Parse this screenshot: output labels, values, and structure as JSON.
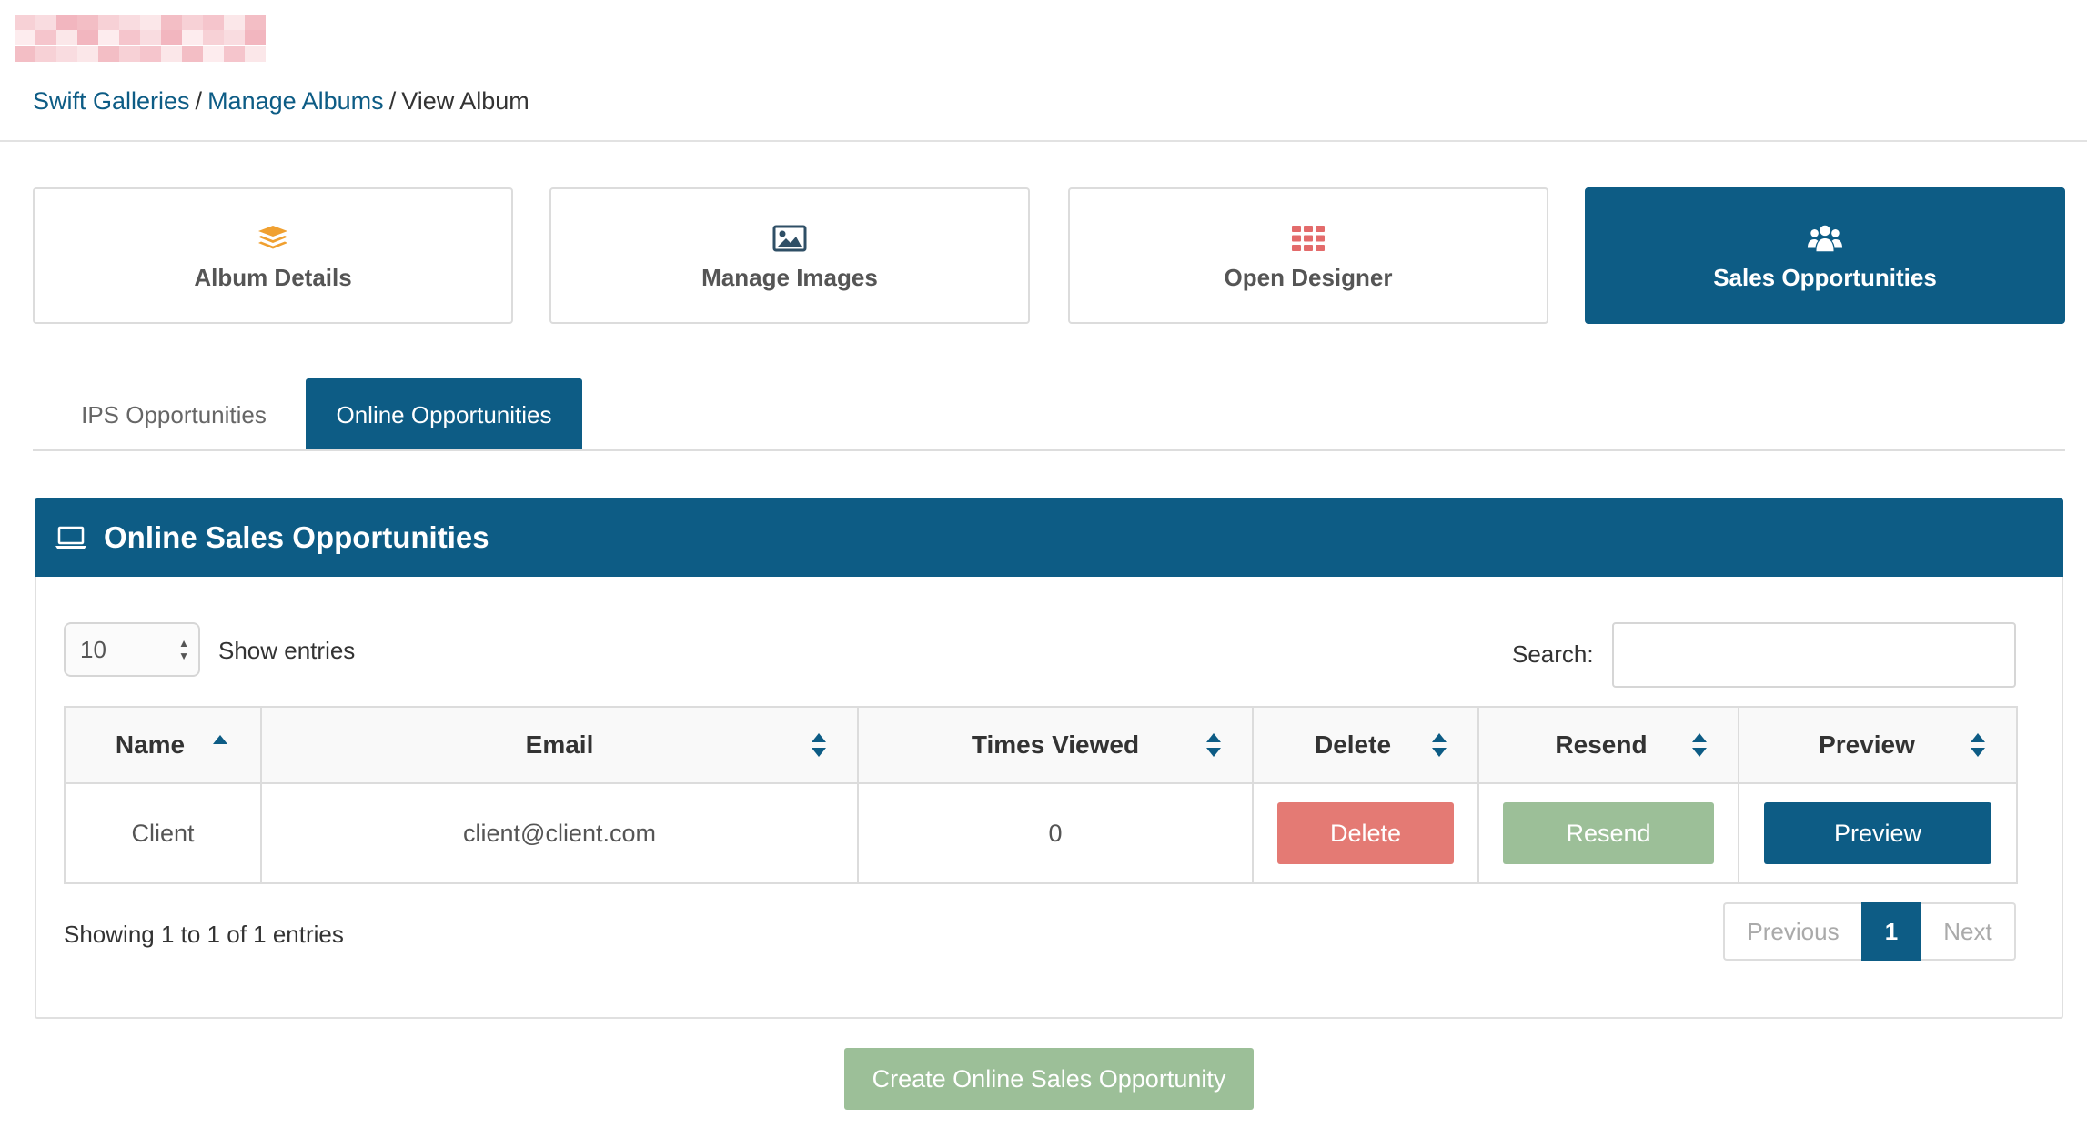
{
  "breadcrumb": {
    "root": "Swift Galleries",
    "sep1": "/",
    "albums": "Manage Albums",
    "sep2": "/",
    "current": "View Album"
  },
  "nav_cards": [
    {
      "label": "Album Details",
      "icon": "layers-icon",
      "color": "#f0a030"
    },
    {
      "label": "Manage Images",
      "icon": "image-icon",
      "color": "#2f4f66"
    },
    {
      "label": "Open Designer",
      "icon": "grid-icon",
      "color": "#e36b6b"
    },
    {
      "label": "Sales Opportunities",
      "icon": "users-icon",
      "color": "#ffffff",
      "active": true
    }
  ],
  "tabs": [
    {
      "label": "IPS Opportunities",
      "active": false
    },
    {
      "label": "Online Opportunities",
      "active": true
    }
  ],
  "panel": {
    "title": "Online Sales Opportunities",
    "icon": "laptop-icon"
  },
  "table_controls": {
    "page_length": "10",
    "show_entries": "Show entries",
    "search_label": "Search:",
    "search_value": ""
  },
  "table": {
    "columns": [
      "Name",
      "Email",
      "Times Viewed",
      "Delete",
      "Resend",
      "Preview"
    ],
    "rows": [
      {
        "name": "Client",
        "email": "client@client.com",
        "times_viewed": "0",
        "delete": "Delete",
        "resend": "Resend",
        "preview": "Preview"
      }
    ]
  },
  "info": "Showing 1 to 1 of 1 entries",
  "pagination": {
    "previous": "Previous",
    "current": "1",
    "next": "Next"
  },
  "create_button": "Create Online Sales Opportunity",
  "colors": {
    "primary": "#0d5c85",
    "danger": "#e47a74",
    "success": "#9cbf98"
  }
}
